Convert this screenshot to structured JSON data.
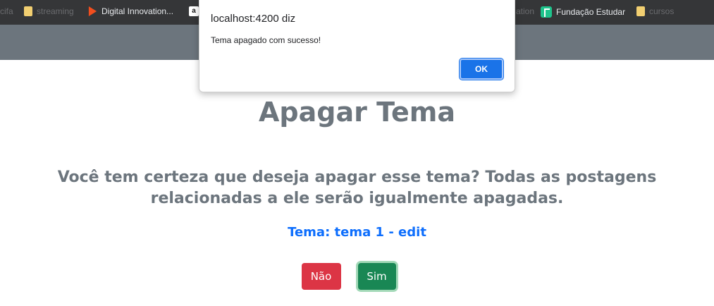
{
  "bookmarks": {
    "items": [
      {
        "label": "cifa",
        "icon": "folder-icon",
        "dim": true
      },
      {
        "label": "streaming",
        "icon": "folder-icon",
        "dim": true
      },
      {
        "label": "Digital Innovation...",
        "icon": "dio-icon",
        "dim": false
      },
      {
        "label": "Fundação Estudar",
        "icon": "fundacao-estudar-icon",
        "dim": false
      },
      {
        "label": "cursos",
        "icon": "folder-icon",
        "dim": true
      },
      {
        "label": "ation",
        "icon": "",
        "dim": true
      }
    ]
  },
  "dialog": {
    "origin": "localhost:4200 diz",
    "message": "Tema apagado com sucesso!",
    "ok_label": "OK"
  },
  "page": {
    "title": "Apagar Tema",
    "question": "Você tem certeza que deseja apagar esse tema? Todas as postagens relacionadas a ele serão igualmente apagadas.",
    "tema_line": "Tema: tema 1 - edit",
    "nao_label": "Não",
    "sim_label": "Sim"
  },
  "colors": {
    "navbar": "#6c757d",
    "danger": "#dc3545",
    "success": "#198754",
    "link": "#0d6efd",
    "dialog_button": "#1a73e8"
  }
}
